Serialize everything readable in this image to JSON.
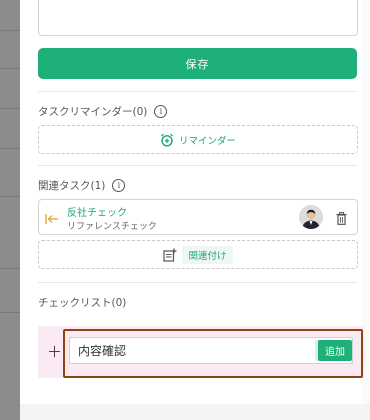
{
  "editor": {
    "description_value": ""
  },
  "save_button": {
    "label": "保存"
  },
  "reminder": {
    "title": "タスクリマインダー(0)",
    "info_icon": "info-icon",
    "add_label": "リマインダー",
    "add_icon": "alarm-plus-icon"
  },
  "related": {
    "title": "関連タスク(1)",
    "info_icon": "info-icon",
    "tasks": [
      {
        "name": "反社チェック",
        "subtitle": "リファレンスチェック",
        "direction_icon": "arrow-left-bar-icon",
        "delete_icon": "trash-icon"
      }
    ],
    "link_label": "関連付け",
    "link_icon": "note-plus-icon"
  },
  "checklist": {
    "title": "チェックリスト(0)",
    "input_value": "内容確認",
    "add_label": "追加",
    "plus_icon": "plus-icon"
  },
  "colors": {
    "accent": "#1fb07a",
    "highlight_border": "#8b4513",
    "highlight_bg": "#fbe9f3"
  }
}
